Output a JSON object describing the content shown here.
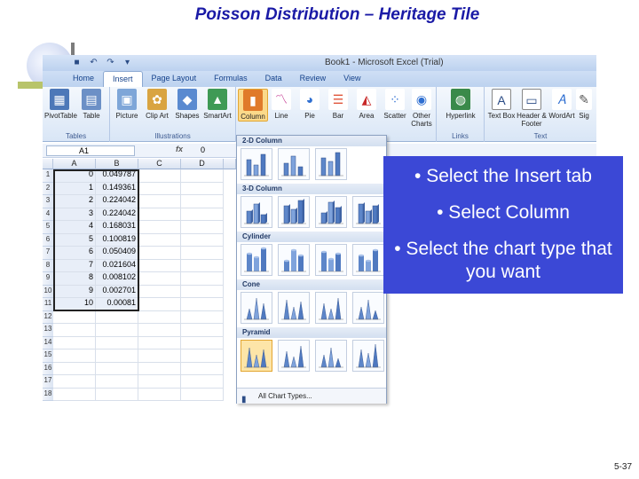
{
  "slide": {
    "title": "Poisson Distribution – Heritage Tile",
    "page_number": "5-37"
  },
  "excel": {
    "window_title": "Book1 - Microsoft Excel (Trial)",
    "tabs": [
      "Home",
      "Insert",
      "Page Layout",
      "Formulas",
      "Data",
      "Review",
      "View"
    ],
    "active_tab": "Insert",
    "groups": {
      "tables": {
        "label": "Tables",
        "buttons": [
          "PivotTable",
          "Table"
        ]
      },
      "illustrations": {
        "label": "Illustrations",
        "buttons": [
          "Picture",
          "Clip Art",
          "Shapes",
          "SmartArt"
        ]
      },
      "charts": {
        "buttons": [
          "Column",
          "Line",
          "Pie",
          "Bar",
          "Area",
          "Scatter",
          "Other Charts"
        ]
      },
      "links": {
        "label": "Links",
        "buttons": [
          "Hyperlink"
        ]
      },
      "text": {
        "label": "Text",
        "buttons": [
          "Text Box",
          "Header & Footer",
          "WordArt",
          "Sig"
        ]
      }
    },
    "name_box": "A1",
    "fx": "fx",
    "formula_value": "0",
    "columns": [
      "A",
      "B",
      "C",
      "D"
    ],
    "rows": [
      {
        "n": "1",
        "a": "0",
        "b": "0.049787"
      },
      {
        "n": "2",
        "a": "1",
        "b": "0.149361"
      },
      {
        "n": "3",
        "a": "2",
        "b": "0.224042"
      },
      {
        "n": "4",
        "a": "3",
        "b": "0.224042"
      },
      {
        "n": "5",
        "a": "4",
        "b": "0.168031"
      },
      {
        "n": "6",
        "a": "5",
        "b": "0.100819"
      },
      {
        "n": "7",
        "a": "6",
        "b": "0.050409"
      },
      {
        "n": "8",
        "a": "7",
        "b": "0.021604"
      },
      {
        "n": "9",
        "a": "8",
        "b": "0.008102"
      },
      {
        "n": "10",
        "a": "9",
        "b": "0.002701"
      },
      {
        "n": "11",
        "a": "10",
        "b": "0.00081"
      },
      {
        "n": "12",
        "a": "",
        "b": ""
      },
      {
        "n": "13",
        "a": "",
        "b": ""
      },
      {
        "n": "14",
        "a": "",
        "b": ""
      },
      {
        "n": "15",
        "a": "",
        "b": ""
      },
      {
        "n": "16",
        "a": "",
        "b": ""
      },
      {
        "n": "17",
        "a": "",
        "b": ""
      },
      {
        "n": "18",
        "a": "",
        "b": ""
      }
    ],
    "dropdown": {
      "sections": [
        "2-D Column",
        "3-D Column",
        "Cylinder",
        "Cone",
        "Pyramid"
      ],
      "footer": "All Chart Types..."
    }
  },
  "callout": {
    "lines": [
      "• Select the Insert tab",
      "• Select Column",
      "• Select the chart type that you want"
    ]
  },
  "colors": {
    "callout_bg": "#3b48d6",
    "title": "#1a1aa6",
    "selected_button": "#fbd98a"
  }
}
